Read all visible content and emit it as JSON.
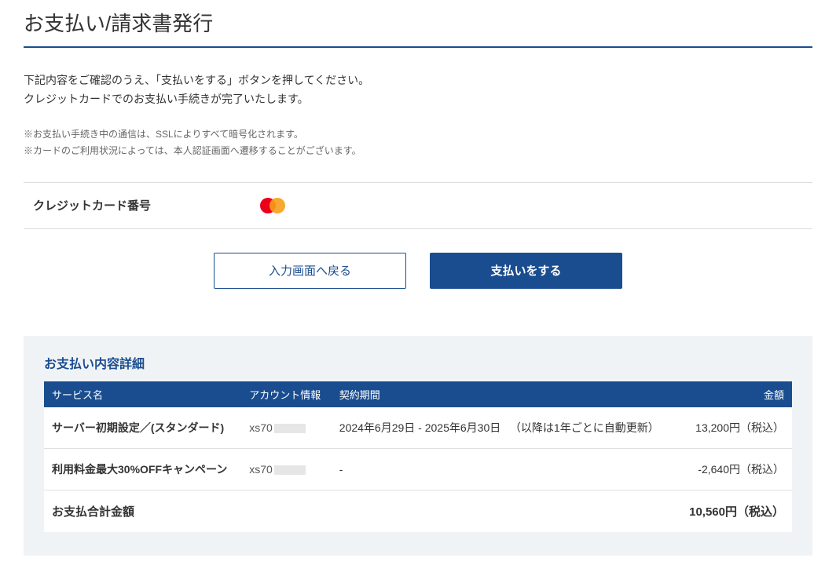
{
  "page": {
    "title": "お支払い/請求書発行",
    "intro_line1": "下記内容をご確認のうえ、「支払いをする」ボタンを押してください。",
    "intro_line2": "クレジットカードでのお支払い手続きが完了いたします。",
    "note1": "※お支払い手続き中の通信は、SSLによりすべて暗号化されます。",
    "note2": "※カードのご利用状況によっては、本人認証画面へ遷移することがございます。"
  },
  "card": {
    "label": "クレジットカード番号"
  },
  "buttons": {
    "back": "入力画面へ戻る",
    "pay": "支払いをする"
  },
  "details": {
    "title": "お支払い内容詳細",
    "headers": {
      "service": "サービス名",
      "account": "アカウント情報",
      "period": "契約期間",
      "amount": "金額"
    },
    "rows": [
      {
        "service": "サーバー初期設定／(スタンダード)",
        "account_prefix": "xs70",
        "period": "2024年6月29日 - 2025年6月30日",
        "renew": "（以降は1年ごとに自動更新）",
        "amount": "13,200円（税込）"
      },
      {
        "service": "利用料金最大30%OFFキャンペーン",
        "account_prefix": "xs70",
        "period": "-",
        "renew": "",
        "amount": "-2,640円（税込）"
      }
    ],
    "total": {
      "label": "お支払合計金額",
      "amount": "10,560円（税込）"
    }
  }
}
